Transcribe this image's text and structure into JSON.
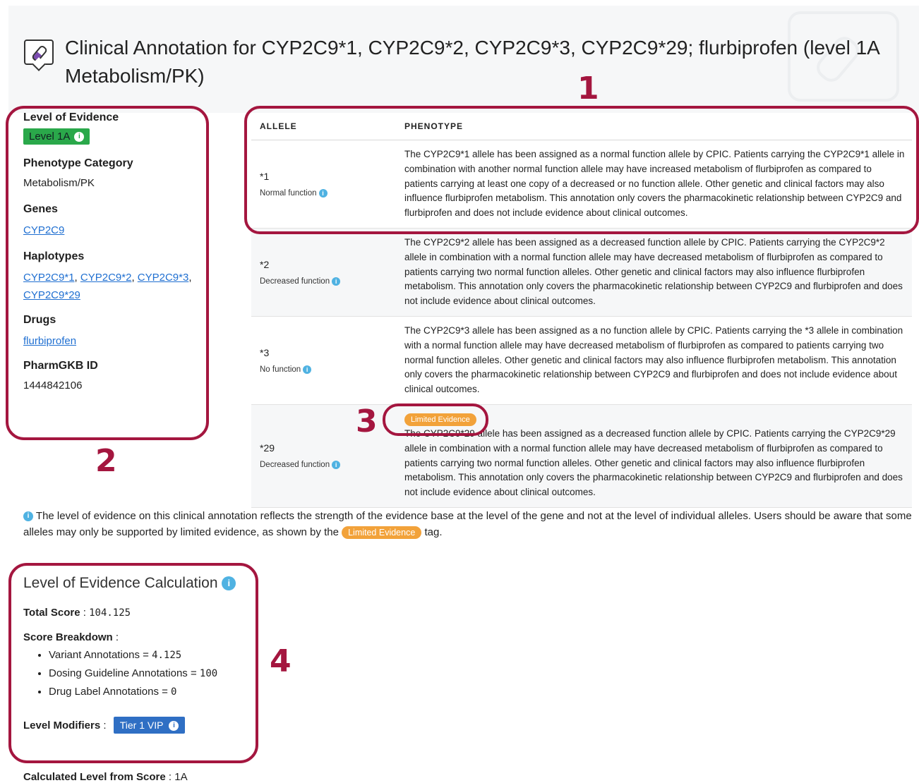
{
  "header": {
    "title": "Clinical Annotation for CYP2C9*1, CYP2C9*2, CYP2C9*3, CYP2C9*29; flurbiprofen (level 1A Metabolism/PK)",
    "icon": "pill-annotation-icon"
  },
  "sidebar": {
    "level_label": "Level of Evidence",
    "level_value": "Level 1A",
    "phenotype_label": "Phenotype Category",
    "phenotype_value": "Metabolism/PK",
    "genes_label": "Genes",
    "genes": [
      "CYP2C9"
    ],
    "haplotypes_label": "Haplotypes",
    "haplotypes": [
      "CYP2C9*1",
      "CYP2C9*2",
      "CYP2C9*3",
      "CYP2C9*29"
    ],
    "drugs_label": "Drugs",
    "drugs": [
      "flurbiprofen"
    ],
    "id_label": "PharmGKB ID",
    "id_value": "1444842106"
  },
  "table": {
    "headers": [
      "ALLELE",
      "PHENOTYPE"
    ],
    "rows": [
      {
        "allele": "*1",
        "function": "Normal function",
        "phenotype": "The CYP2C9*1 allele has been assigned as a normal function allele by CPIC. Patients carrying the CYP2C9*1 allele in combination with another normal function allele may have increased metabolism of flurbiprofen as compared to patients carrying at least one copy of a decreased or no function allele. Other genetic and clinical factors may also influence flurbiprofen metabolism. This annotation only covers the pharmacokinetic relationship between CYP2C9 and flurbiprofen and does not include evidence about clinical outcomes."
      },
      {
        "allele": "*2",
        "function": "Decreased function",
        "phenotype": "The CYP2C9*2 allele has been assigned as a decreased function allele by CPIC. Patients carrying the CYP2C9*2 allele in combination with a normal function allele may have decreased metabolism of flurbiprofen as compared to patients carrying two normal function alleles. Other genetic and clinical factors may also influence flurbiprofen metabolism. This annotation only covers the pharmacokinetic relationship between CYP2C9 and flurbiprofen and does not include evidence about clinical outcomes."
      },
      {
        "allele": "*3",
        "function": "No function",
        "phenotype": "The CYP2C9*3 allele has been assigned as a no function allele by CPIC. Patients carrying the *3 allele in combination with a normal function allele may have decreased metabolism of flurbiprofen as compared to patients carrying two normal function alleles. Other genetic and clinical factors may also influence flurbiprofen metabolism. This annotation only covers the pharmacokinetic relationship between CYP2C9 and flurbiprofen and does not include evidence about clinical outcomes."
      },
      {
        "allele": "*29",
        "function": "Decreased function",
        "tag": "Limited Evidence",
        "phenotype": "The CYP2C9*29 allele has been assigned as a decreased function allele by CPIC. Patients carrying the CYP2C9*29 allele in combination with a normal function allele may have decreased metabolism of flurbiprofen as compared to patients carrying two normal function alleles. Other genetic and clinical factors may also influence flurbiprofen metabolism. This annotation only covers the pharmacokinetic relationship between CYP2C9 and flurbiprofen and does not include evidence about clinical outcomes."
      }
    ]
  },
  "note": {
    "text_before": "The level of evidence on this clinical annotation reflects the strength of the evidence base at the level of the gene and not at the level of individual alleles. Users should be aware that some alleles may only be supported by limited evidence, as shown by the",
    "tag": "Limited Evidence",
    "text_after": "tag."
  },
  "calculation": {
    "title": "Level of Evidence Calculation",
    "total_label": "Total Score",
    "total_value": "104.125",
    "breakdown_label": "Score Breakdown",
    "breakdown": [
      {
        "label": "Variant Annotations = ",
        "value": "4.125"
      },
      {
        "label": "Dosing Guideline Annotations = ",
        "value": "100"
      },
      {
        "label": "Drug Label Annotations = ",
        "value": "0"
      }
    ],
    "modifiers_label": "Level Modifiers",
    "modifier_badge": "Tier 1 VIP",
    "calculated_label": "Calculated Level from Score",
    "calculated_value": "1A"
  },
  "callouts": [
    "1",
    "2",
    "3",
    "4"
  ],
  "colors": {
    "callout": "#a4163f",
    "level_badge": "#2aa84a",
    "limited_tag": "#f2a23a",
    "tier_badge": "#2f6fc4",
    "info_icon": "#4fb2e2",
    "link": "#1f6fd1"
  }
}
